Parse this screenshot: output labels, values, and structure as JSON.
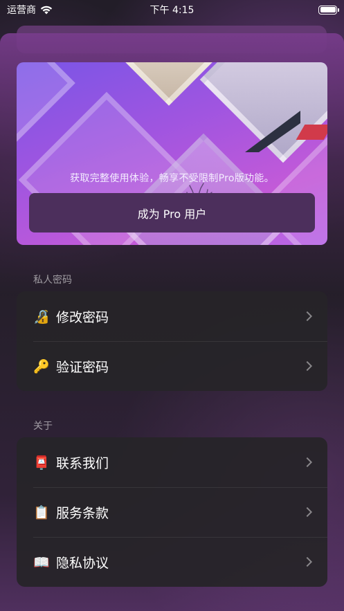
{
  "status_bar": {
    "carrier": "运营商",
    "time": "下午 4:15"
  },
  "promo": {
    "description": "获取完整使用体验，畅享不受限制Pro版功能。",
    "button_label": "成为 Pro 用户"
  },
  "sections": [
    {
      "title": "私人密码",
      "items": [
        {
          "icon": "🔏",
          "label": "修改密码"
        },
        {
          "icon": "🔑",
          "label": "验证密码"
        }
      ]
    },
    {
      "title": "关于",
      "items": [
        {
          "icon": "📮",
          "label": "联系我们"
        },
        {
          "icon": "📋",
          "label": "服务条款"
        },
        {
          "icon": "📖",
          "label": "隐私协议"
        }
      ]
    }
  ]
}
